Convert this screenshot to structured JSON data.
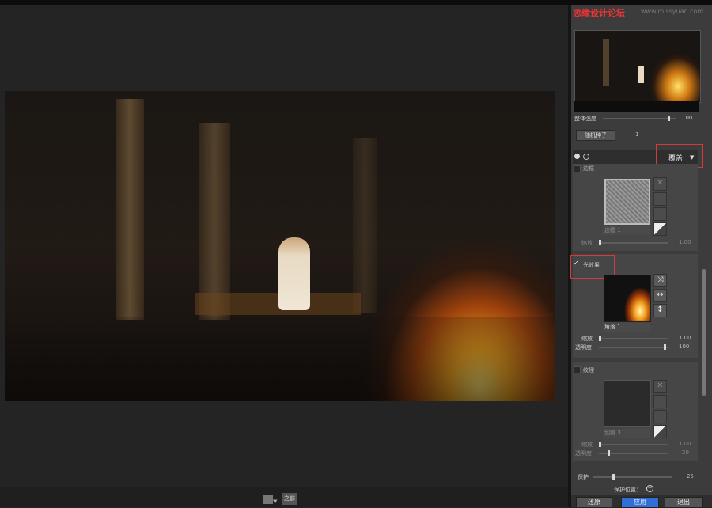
{
  "watermark": {
    "left": "思缘设计论坛",
    "right": "www.missyuan.com"
  },
  "panel": {
    "overall_opacity": {
      "label": "整体强度",
      "value": "100"
    },
    "random_seed": {
      "button": "随机种子",
      "value": "1"
    },
    "blend_mode": {
      "value": "覆盖"
    },
    "border": {
      "label": "边框",
      "checked": false,
      "preset": "边框 1",
      "scale_label": "缩放",
      "scale_value": "1.00"
    },
    "light_effect": {
      "label": "光效果",
      "checked": true,
      "check_mark": "✓",
      "preset": "角落 1",
      "scale_label": "缩放",
      "scale_value": "1.00",
      "opacity_label": "透明度",
      "opacity_value": "100"
    },
    "texture": {
      "label": "纹理",
      "checked": false,
      "preset": "划痕 3",
      "scale_label": "缩放",
      "scale_value": "1.00",
      "opacity_label": "透明度",
      "opacity_value": "20"
    },
    "protect": {
      "label": "保护",
      "value": "25",
      "position_label": "保护位置："
    }
  },
  "footer": {
    "reset": "还原",
    "apply": "应用",
    "exit": "退出"
  },
  "bottom_bar": {
    "button": "之前"
  },
  "icons": {
    "shuffle": "shuffle-icon",
    "flip_h": "flip-horizontal-icon",
    "flip_v": "flip-vertical-icon",
    "crosshair": "crosshair-icon"
  },
  "colors": {
    "accent": "#2f6fd6",
    "highlight": "#d23b3b"
  }
}
